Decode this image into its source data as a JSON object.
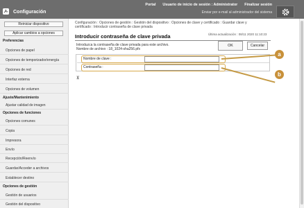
{
  "header": {
    "app_title": "Configuración",
    "links": [
      "Portal",
      "Usuario de inicio de sesión : Administrator",
      "Finalizar sesión"
    ],
    "mail_link": "Enviar por e-mail al administrador del sistema",
    "settings_icon": "gear-icon",
    "logo_icon": "wrench-icon"
  },
  "sidebar": {
    "restart_label": "Reiniciar dispositivo",
    "apply_label": "Aplicar cambios a opciones",
    "sections": [
      {
        "heading": "Preferencias",
        "items": [
          "Opciones de papel",
          "Opciones de temporizador/energía",
          "Opciones de red",
          "Interfaz externa",
          "Opciones de volumen"
        ]
      },
      {
        "heading": "Ajuste/Mantenimiento",
        "items": [
          "Ajustar calidad de imagen"
        ]
      },
      {
        "heading": "Opciones de funciones",
        "items": [
          "Opciones comunes",
          "Copia",
          "Impresora",
          "Envío",
          "Recepción/Reenvío",
          "Guardar/Acceder a archivos",
          "Establecer destino"
        ]
      },
      {
        "heading": "Opciones de gestión",
        "items": [
          "Gestión de usuarios",
          "Gestión del dispositivo"
        ]
      }
    ]
  },
  "main": {
    "breadcrumb": "Configuración : Opciones de gestión : Gestión del dispositivo : Opciones de clave y certificado : Guardar clave y certificado : Introducir contraseña de clave privada",
    "title": "Introducir contraseña de clave privada",
    "last_updated": "Última actualización : 08/11 2020 11:10:23",
    "description_line1": "Introduzca la contraseña de clave privada para este archivo.",
    "description_line2": "Nombre de archivo : 18_1024-sha256.pfx",
    "ok_label": "OK",
    "cancel_label": "Cancelar",
    "fields": [
      {
        "label": "Nombre de clave :",
        "value": ""
      },
      {
        "label": "Contraseña :",
        "value": ""
      }
    ],
    "collapse_icon": "collapse-icon"
  },
  "callouts": {
    "a": "a",
    "b": "b"
  },
  "colors": {
    "header": "#6d6d6d",
    "callout": "#c8913a",
    "highlight": "#d7a94b"
  }
}
